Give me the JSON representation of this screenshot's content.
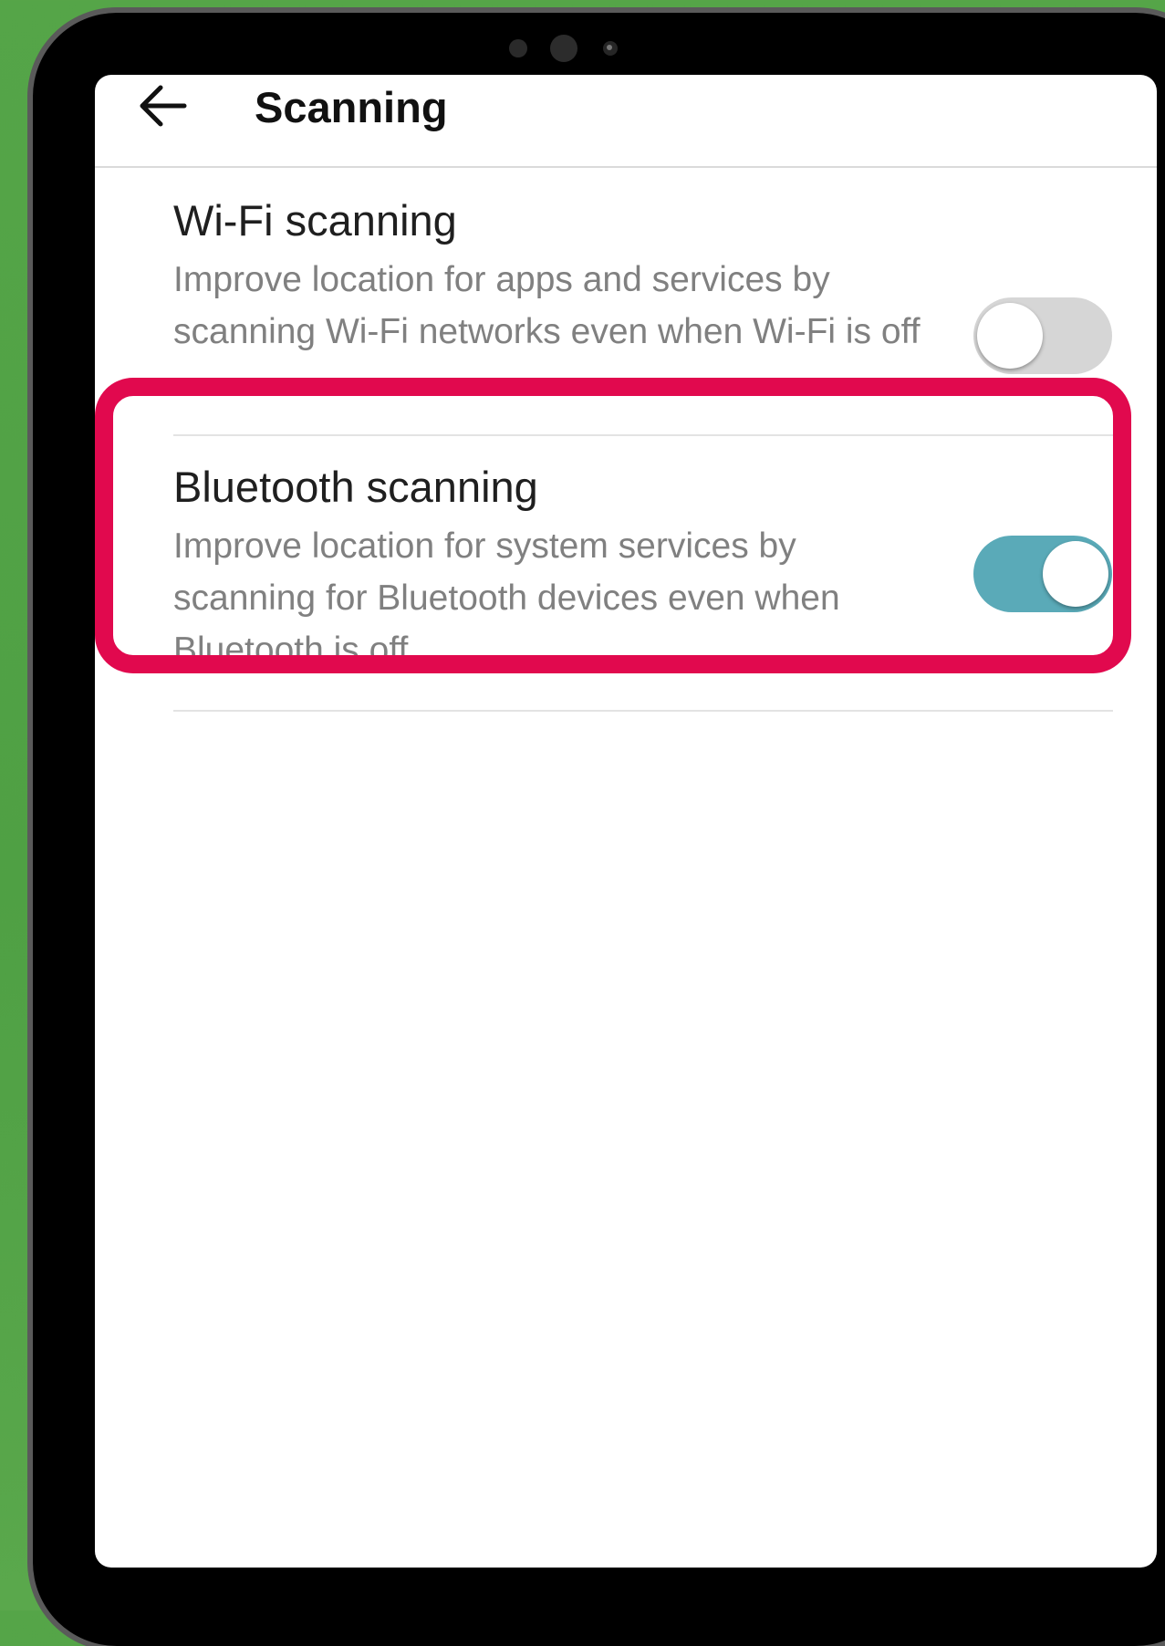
{
  "header": {
    "title": "Scanning",
    "back_icon": "arrow-left-icon"
  },
  "settings": [
    {
      "title": "Wi-Fi scanning",
      "description": "Improve location for apps and services by scanning Wi-Fi networks even when Wi-Fi is off",
      "enabled": false
    },
    {
      "title": "Bluetooth scanning",
      "description": "Improve location for system services by scanning for Bluetooth devices even when Bluetooth is off",
      "enabled": true
    }
  ],
  "colors": {
    "background": "#55a548",
    "toggle_on": "#5aaab8",
    "toggle_off": "#d6d6d6",
    "highlight": "#e1094e"
  }
}
